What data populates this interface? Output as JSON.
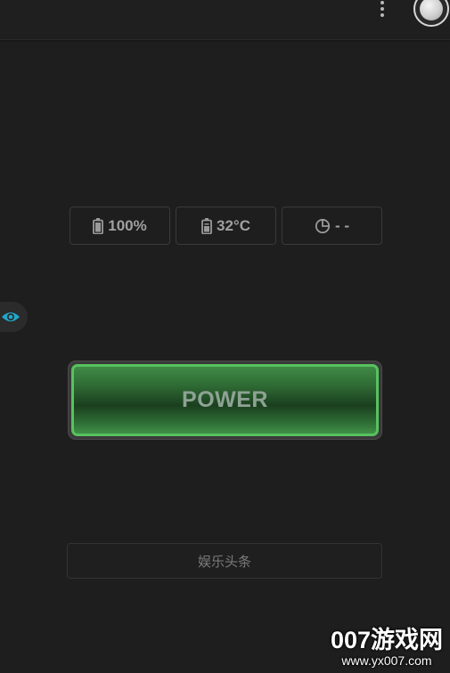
{
  "stats": {
    "battery": "100%",
    "temperature": "32°C",
    "time": "- -"
  },
  "power_button": {
    "label": "POWER"
  },
  "news_button": {
    "label": "娱乐头条"
  },
  "watermark": {
    "brand": "007游戏网",
    "url": "www.yx007.com"
  },
  "icons": {
    "menu": "more-vert-icon",
    "toggle": "toggle-knob",
    "battery": "battery-icon",
    "temperature": "thermometer-battery-icon",
    "time": "pie-clock-icon",
    "eye": "eye-icon"
  },
  "colors": {
    "background": "#1e1e1e",
    "power_green": "#56c25e",
    "eye_accent": "#1fa8c9"
  }
}
